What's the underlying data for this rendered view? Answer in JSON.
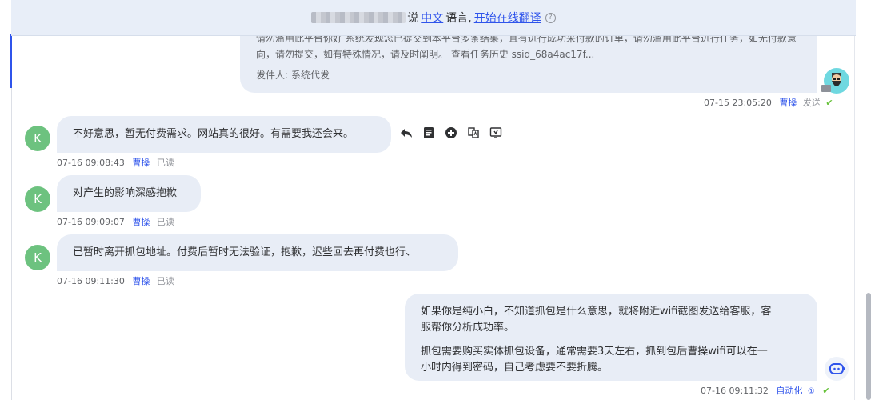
{
  "translate_bar": {
    "prefix_text": "说",
    "lang_link": "中文",
    "lang_suffix": "语言,",
    "translate_link": "开始在线翻译",
    "help_glyph": "?"
  },
  "messages": [
    {
      "id": "m0",
      "direction": "out",
      "lines": [
        "请勿滥用此平台你好 系统发现您已提交到本平台多条结果，且有进行成功来付款的订单，请勿滥用此平台进行任务，如无付款意",
        "向，请勿提交，如有特殊情况，请及时阐明。 查看任务历史 ssid_68a4ac17f..."
      ],
      "sender_line": "发件人: 系统代发",
      "time": "07-15 23:05:20",
      "author": "曹操",
      "status": "发送",
      "status_icon": "check-circle-icon"
    },
    {
      "id": "m1",
      "direction": "in",
      "avatar_letter": "K",
      "text": "不好意思，暂无付费需求。网站真的很好。有需要我还会来。",
      "time": "07-16 09:08:43",
      "author": "曹操",
      "status": "已读"
    },
    {
      "id": "m2",
      "direction": "in",
      "avatar_letter": "K",
      "text": "对产生的影响深感抱歉",
      "time": "07-16 09:09:07",
      "author": "曹操",
      "status": "已读"
    },
    {
      "id": "m3",
      "direction": "in",
      "avatar_letter": "K",
      "text": "已暂时离开抓包地址。付费后暂时无法验证，抱歉，迟些回去再付费也行、",
      "time": "07-16 09:11:30",
      "author": "曹操",
      "status": "已读"
    },
    {
      "id": "m4",
      "direction": "out",
      "para1": [
        "如果你是纯小白，不知道抓包是什么意思，就将附近wifi截图发送给客服，客",
        "服帮你分析成功率。"
      ],
      "para2": [
        "抓包需要购买实体抓包设备，通常需要3天左右，抓到包后曹操wifi可以在一",
        "小时内得到密码，自己考虑要不要折腾。"
      ],
      "time": "07-16 09:11:32",
      "author": "自动化",
      "info_glyph": "①",
      "status_icon": "check-circle-icon"
    }
  ],
  "toolbar_icons": [
    "reply-icon",
    "note-icon",
    "add-circle-icon",
    "translate-icon",
    "screen-icon"
  ],
  "colors": {
    "accent": "#2f54eb",
    "bubble_bg": "#e8edf6",
    "avatar_k": "#6dc27f",
    "check": "#67c23a",
    "translate_bar_bg": "#e8eef8"
  }
}
